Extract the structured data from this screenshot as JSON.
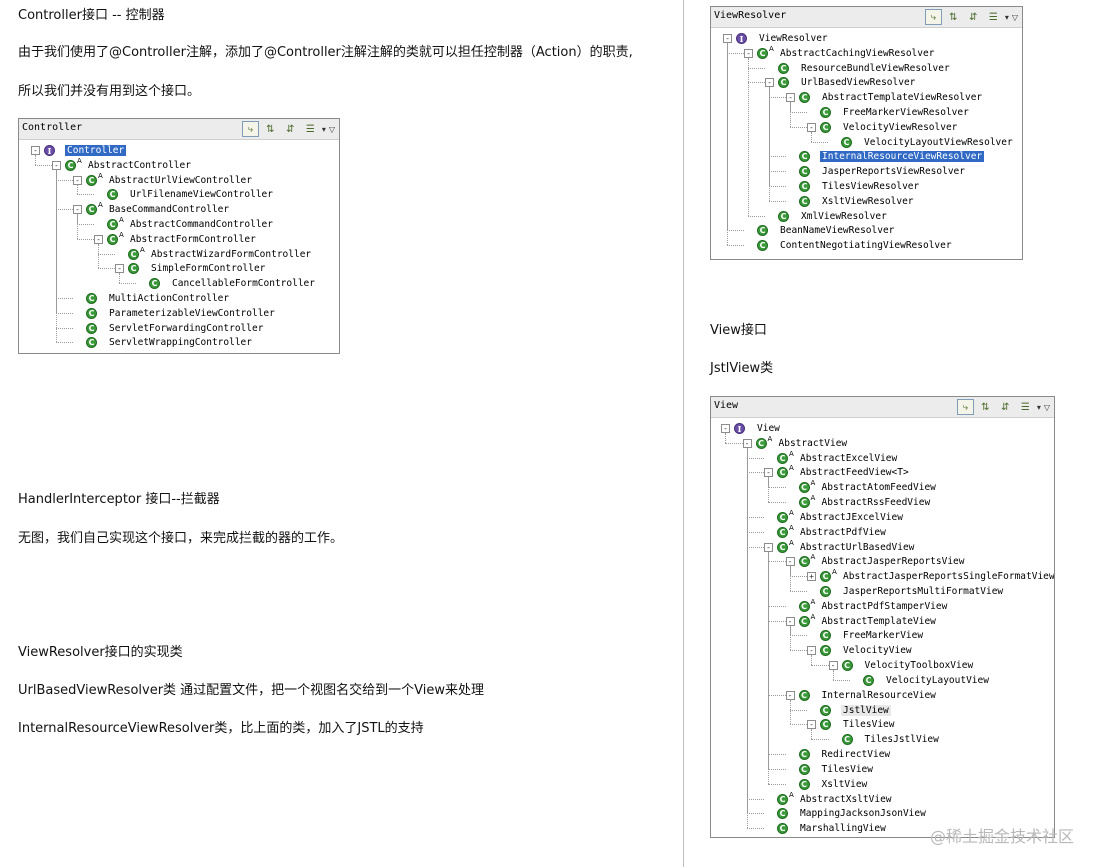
{
  "left_column": {
    "controller_heading": "Controller接口 -- 控制器",
    "controller_text_1": "由于我们使用了@Controller注解，添加了@Controller注解注解的类就可以担任控制器（Action）的职责,",
    "controller_text_2": "所以我们并没有用到这个接口。",
    "handler_heading": "HandlerInterceptor 接口--拦截器",
    "handler_text": "无图，我们自己实现这个接口，来完成拦截的器的工作。",
    "viewresolver_heading": "ViewResolver接口的实现类",
    "urlbased_text": "UrlBasedViewResolver类 通过配置文件，把一个视图名交给到一个View来处理",
    "internal_text": "InternalResourceViewResolver类，比上面的类，加入了JSTL的支持"
  },
  "right_column": {
    "view_heading": "View接口",
    "jstlview_heading": "JstlView类"
  },
  "toolbar_icons": [
    "type-hierarchy-icon",
    "supertype-hierarchy-icon",
    "subtype-hierarchy-icon",
    "history-list-icon",
    "dropdown-arrow-icon",
    "view-menu-icon"
  ],
  "controller_panel": {
    "title": "Controller",
    "nodes": [
      {
        "label": "Controller",
        "depth": 0,
        "kind": "interface",
        "expander": "-",
        "abstract": false,
        "selected": true
      },
      {
        "label": "AbstractController",
        "depth": 1,
        "kind": "class",
        "expander": "-",
        "abstract": true
      },
      {
        "label": "AbstractUrlViewController",
        "depth": 2,
        "kind": "class",
        "expander": "-",
        "abstract": true
      },
      {
        "label": "UrlFilenameViewController",
        "depth": 3,
        "kind": "class",
        "expander": "",
        "abstract": false
      },
      {
        "label": "BaseCommandController",
        "depth": 2,
        "kind": "class",
        "expander": "-",
        "abstract": true
      },
      {
        "label": "AbstractCommandController",
        "depth": 3,
        "kind": "class",
        "expander": "",
        "abstract": true
      },
      {
        "label": "AbstractFormController",
        "depth": 3,
        "kind": "class",
        "expander": "-",
        "abstract": true
      },
      {
        "label": "AbstractWizardFormController",
        "depth": 4,
        "kind": "class",
        "expander": "",
        "abstract": true
      },
      {
        "label": "SimpleFormController",
        "depth": 4,
        "kind": "class",
        "expander": "-",
        "abstract": false
      },
      {
        "label": "CancellableFormController",
        "depth": 5,
        "kind": "class",
        "expander": "",
        "abstract": false
      },
      {
        "label": "MultiActionController",
        "depth": 2,
        "kind": "class",
        "expander": "",
        "abstract": false
      },
      {
        "label": "ParameterizableViewController",
        "depth": 2,
        "kind": "class",
        "expander": "",
        "abstract": false
      },
      {
        "label": "ServletForwardingController",
        "depth": 2,
        "kind": "class",
        "expander": "",
        "abstract": false
      },
      {
        "label": "ServletWrappingController",
        "depth": 2,
        "kind": "class",
        "expander": "",
        "abstract": false
      }
    ]
  },
  "viewresolver_panel": {
    "title": "ViewResolver",
    "nodes": [
      {
        "label": "ViewResolver",
        "depth": 0,
        "kind": "interface",
        "expander": "-",
        "abstract": false
      },
      {
        "label": "AbstractCachingViewResolver",
        "depth": 1,
        "kind": "class",
        "expander": "-",
        "abstract": true
      },
      {
        "label": "ResourceBundleViewResolver",
        "depth": 2,
        "kind": "class",
        "expander": "",
        "abstract": false
      },
      {
        "label": "UrlBasedViewResolver",
        "depth": 2,
        "kind": "class",
        "expander": "-",
        "abstract": false
      },
      {
        "label": "AbstractTemplateViewResolver",
        "depth": 3,
        "kind": "class",
        "expander": "-",
        "abstract": false
      },
      {
        "label": "FreeMarkerViewResolver",
        "depth": 4,
        "kind": "class",
        "expander": "",
        "abstract": false
      },
      {
        "label": "VelocityViewResolver",
        "depth": 4,
        "kind": "class",
        "expander": "-",
        "abstract": false
      },
      {
        "label": "VelocityLayoutViewResolver",
        "depth": 5,
        "kind": "class",
        "expander": "",
        "abstract": false
      },
      {
        "label": "InternalResourceViewResolver",
        "depth": 3,
        "kind": "class",
        "expander": "",
        "abstract": false,
        "selected": true
      },
      {
        "label": "JasperReportsViewResolver",
        "depth": 3,
        "kind": "class",
        "expander": "",
        "abstract": false
      },
      {
        "label": "TilesViewResolver",
        "depth": 3,
        "kind": "class",
        "expander": "",
        "abstract": false
      },
      {
        "label": "XsltViewResolver",
        "depth": 3,
        "kind": "class",
        "expander": "",
        "abstract": false
      },
      {
        "label": "XmlViewResolver",
        "depth": 2,
        "kind": "class",
        "expander": "",
        "abstract": false
      },
      {
        "label": "BeanNameViewResolver",
        "depth": 1,
        "kind": "class",
        "expander": "",
        "abstract": false
      },
      {
        "label": "ContentNegotiatingViewResolver",
        "depth": 1,
        "kind": "class",
        "expander": "",
        "abstract": false
      }
    ]
  },
  "view_panel": {
    "title": "View",
    "nodes": [
      {
        "label": "View",
        "depth": 0,
        "kind": "interface",
        "expander": "-",
        "abstract": false
      },
      {
        "label": "AbstractView",
        "depth": 1,
        "kind": "class",
        "expander": "-",
        "abstract": true
      },
      {
        "label": "AbstractExcelView",
        "depth": 2,
        "kind": "class",
        "expander": "",
        "abstract": true
      },
      {
        "label": "AbstractFeedView<T>",
        "depth": 2,
        "kind": "class",
        "expander": "-",
        "abstract": true
      },
      {
        "label": "AbstractAtomFeedView",
        "depth": 3,
        "kind": "class",
        "expander": "",
        "abstract": true
      },
      {
        "label": "AbstractRssFeedView",
        "depth": 3,
        "kind": "class",
        "expander": "",
        "abstract": true
      },
      {
        "label": "AbstractJExcelView",
        "depth": 2,
        "kind": "class",
        "expander": "",
        "abstract": true
      },
      {
        "label": "AbstractPdfView",
        "depth": 2,
        "kind": "class",
        "expander": "",
        "abstract": true
      },
      {
        "label": "AbstractUrlBasedView",
        "depth": 2,
        "kind": "class",
        "expander": "-",
        "abstract": true
      },
      {
        "label": "AbstractJasperReportsView",
        "depth": 3,
        "kind": "class",
        "expander": "-",
        "abstract": true
      },
      {
        "label": "AbstractJasperReportsSingleFormatView",
        "depth": 4,
        "kind": "class",
        "expander": "+",
        "abstract": true
      },
      {
        "label": "JasperReportsMultiFormatView",
        "depth": 4,
        "kind": "class",
        "expander": "",
        "abstract": false
      },
      {
        "label": "AbstractPdfStamperView",
        "depth": 3,
        "kind": "class",
        "expander": "",
        "abstract": true
      },
      {
        "label": "AbstractTemplateView",
        "depth": 3,
        "kind": "class",
        "expander": "-",
        "abstract": true
      },
      {
        "label": "FreeMarkerView",
        "depth": 4,
        "kind": "class",
        "expander": "",
        "abstract": false
      },
      {
        "label": "VelocityView",
        "depth": 4,
        "kind": "class",
        "expander": "-",
        "abstract": false
      },
      {
        "label": "VelocityToolboxView",
        "depth": 5,
        "kind": "class",
        "expander": "-",
        "abstract": false
      },
      {
        "label": "VelocityLayoutView",
        "depth": 6,
        "kind": "class",
        "expander": "",
        "abstract": false
      },
      {
        "label": "InternalResourceView",
        "depth": 3,
        "kind": "class",
        "expander": "-",
        "abstract": false
      },
      {
        "label": "JstlView",
        "depth": 4,
        "kind": "class",
        "expander": "",
        "abstract": false,
        "highlighted": true
      },
      {
        "label": "TilesView",
        "depth": 4,
        "kind": "class",
        "expander": "-",
        "abstract": false
      },
      {
        "label": "TilesJstlView",
        "depth": 5,
        "kind": "class",
        "expander": "",
        "abstract": false
      },
      {
        "label": "RedirectView",
        "depth": 3,
        "kind": "class",
        "expander": "",
        "abstract": false
      },
      {
        "label": "TilesView",
        "depth": 3,
        "kind": "class",
        "expander": "",
        "abstract": false
      },
      {
        "label": "XsltView",
        "depth": 3,
        "kind": "class",
        "expander": "",
        "abstract": false
      },
      {
        "label": "AbstractXsltView",
        "depth": 2,
        "kind": "class",
        "expander": "",
        "abstract": true
      },
      {
        "label": "MappingJacksonJsonView",
        "depth": 2,
        "kind": "class",
        "expander": "",
        "abstract": false
      },
      {
        "label": "MarshallingView",
        "depth": 2,
        "kind": "class",
        "expander": "",
        "abstract": false
      }
    ]
  },
  "watermark": "@稀土掘金技术社区"
}
